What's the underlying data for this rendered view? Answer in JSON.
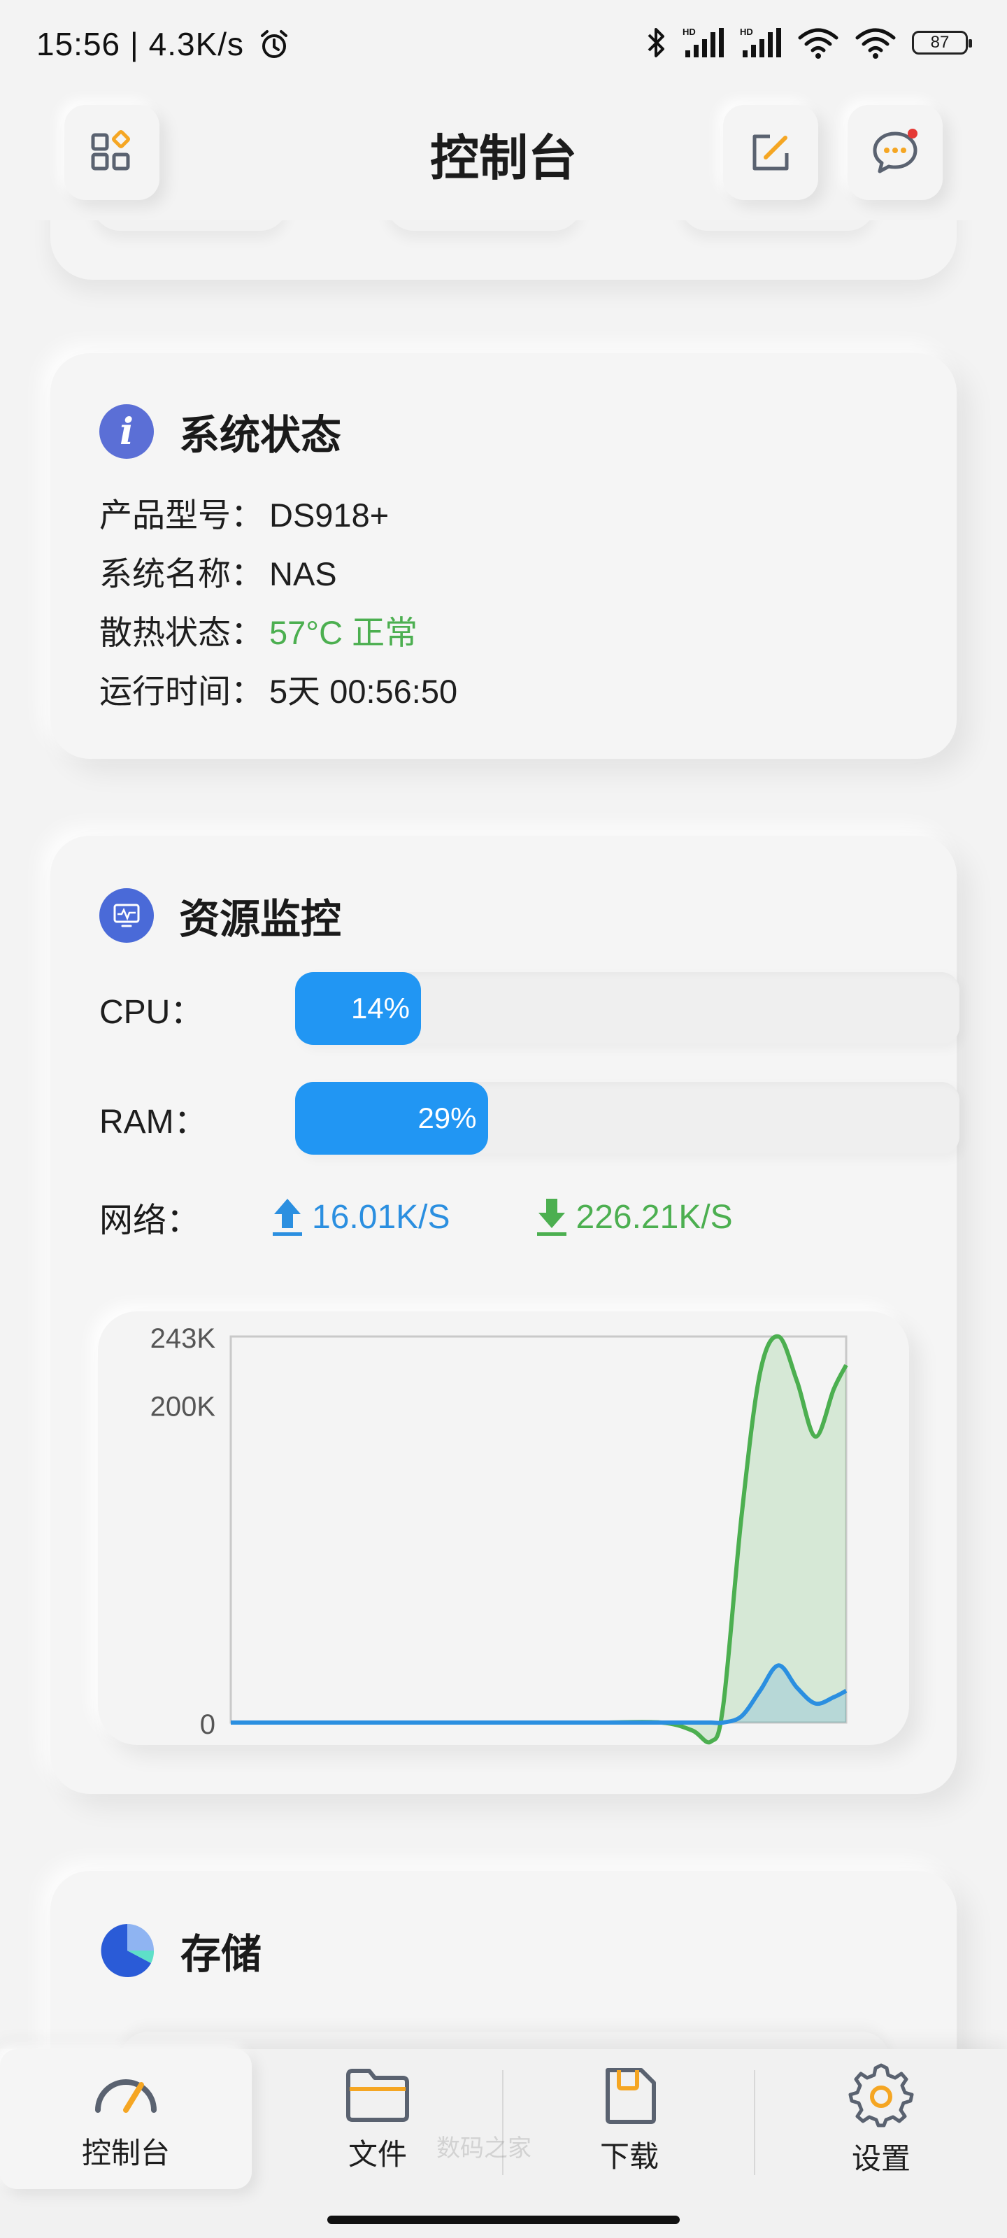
{
  "status_bar": {
    "time": "15:56",
    "speed": "4.3K/s",
    "battery": "87"
  },
  "header": {
    "title": "控制台"
  },
  "system_status": {
    "title": "系统状态",
    "rows": [
      {
        "label": "产品型号：",
        "value": "DS918+"
      },
      {
        "label": "系统名称：",
        "value": "NAS"
      },
      {
        "label": "散热状态：",
        "value": "57°C 正常"
      },
      {
        "label": "运行时间：",
        "value": "5天 00:56:50"
      }
    ]
  },
  "resource_monitor": {
    "title": "资源监控",
    "cpu": {
      "label": "CPU：",
      "percent": 14,
      "text": "14%"
    },
    "ram": {
      "label": "RAM：",
      "percent": 29,
      "text": "29%"
    },
    "network": {
      "label": "网络：",
      "upload": "16.01K/S",
      "download": "226.21K/S"
    },
    "colors": {
      "upload": "#2b8fe0",
      "download": "#4caf50",
      "bar": "#2196f3"
    }
  },
  "chart_data": {
    "type": "area",
    "y_tick_labels": [
      "243K",
      "200K",
      "0"
    ],
    "ylim": [
      0,
      243
    ],
    "x": [
      0,
      10,
      20,
      30,
      40,
      50,
      60,
      70,
      75,
      78,
      80,
      83,
      86,
      89,
      92,
      95,
      98,
      100
    ],
    "series": [
      {
        "values": [
          0,
          0,
          0,
          0,
          0,
          0,
          0,
          0,
          0,
          0,
          0,
          4,
          20,
          36,
          22,
          12,
          16,
          20
        ]
      },
      {
        "values": [
          0,
          0,
          0,
          0,
          0,
          0,
          0,
          0,
          -5,
          -12,
          10,
          130,
          220,
          243,
          215,
          180,
          210,
          225
        ]
      }
    ],
    "grid": false
  },
  "storage": {
    "title": "存储"
  },
  "bottom_nav": {
    "items": [
      {
        "label": "控制台",
        "icon": "dashboard-gauge-icon"
      },
      {
        "label": "文件",
        "icon": "folder-icon"
      },
      {
        "label": "下载",
        "icon": "download-sd-icon"
      },
      {
        "label": "设置",
        "icon": "gear-icon"
      }
    ]
  },
  "watermark": "数码之家"
}
